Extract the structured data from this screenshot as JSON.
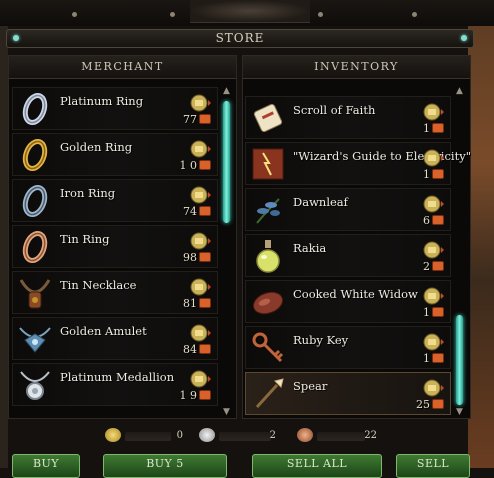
{
  "store": {
    "title": "STORE"
  },
  "merchant": {
    "header": "MERCHANT",
    "items": [
      {
        "name": "Platinum Ring",
        "price": "77",
        "icon": "platinum-ring-icon"
      },
      {
        "name": "Golden Ring",
        "price": "1 0",
        "icon": "golden-ring-icon"
      },
      {
        "name": "Iron Ring",
        "price": "74",
        "icon": "iron-ring-icon"
      },
      {
        "name": "Tin Ring",
        "price": "98",
        "icon": "tin-ring-icon"
      },
      {
        "name": "Tin Necklace",
        "price": "81",
        "icon": "tin-necklace-icon"
      },
      {
        "name": "Golden Amulet",
        "price": "84",
        "icon": "golden-amulet-icon"
      },
      {
        "name": "Platinum Medallion",
        "price": "1 9",
        "icon": "platinum-medallion-icon"
      }
    ]
  },
  "inventory": {
    "header": "INVENTORY",
    "items": [
      {
        "name": "Scroll of Faith",
        "price": "1",
        "icon": "scroll-icon"
      },
      {
        "name": "\"Wizard's Guide to Electricity\"",
        "price": "1",
        "icon": "book-icon"
      },
      {
        "name": "Dawnleaf",
        "price": "6",
        "icon": "herb-icon"
      },
      {
        "name": "Rakia",
        "price": "2",
        "icon": "potion-bottle-icon"
      },
      {
        "name": "Cooked White Widow",
        "price": "1",
        "icon": "cooked-meat-icon"
      },
      {
        "name": "Ruby Key",
        "price": "1",
        "icon": "key-icon"
      },
      {
        "name": "Spear",
        "price": "25",
        "icon": "spear-icon"
      }
    ]
  },
  "currency": {
    "gold": "0",
    "silver": "2",
    "copper": "22"
  },
  "buttons": {
    "buy": "BUY",
    "buy5": "BUY 5",
    "sell_all": "SELL ALL",
    "sell": "SELL"
  },
  "colors": {
    "accent": "#7ff0de",
    "button_green": "#3f7a33",
    "price_marker": "#d8622a"
  }
}
